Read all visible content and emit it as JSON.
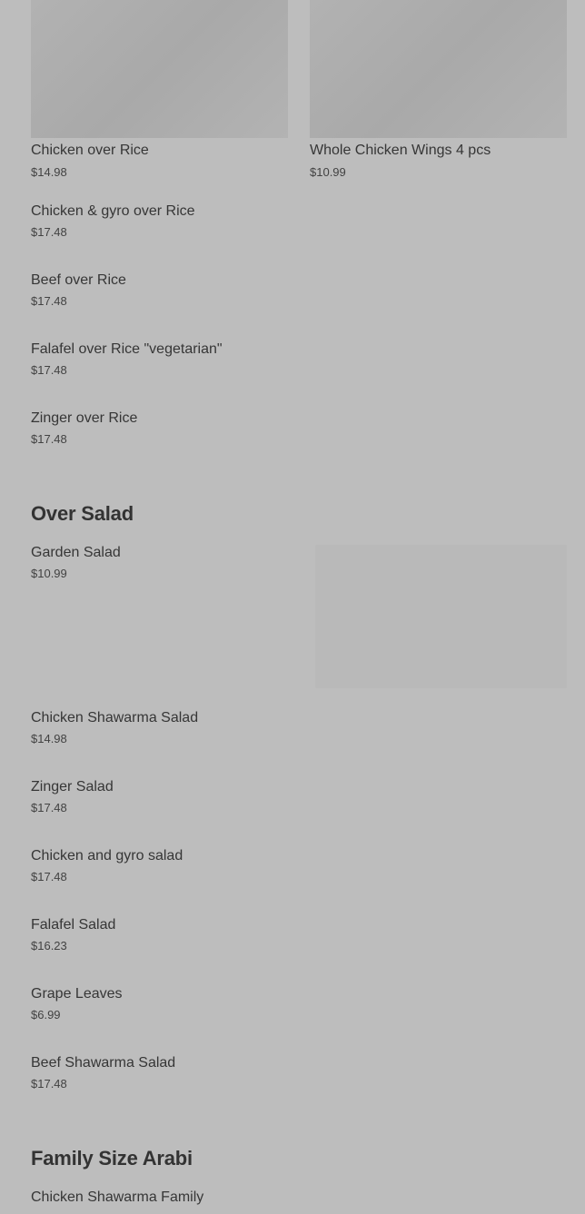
{
  "grid_items": [
    {
      "name": "Chicken over Rice",
      "price": "$14.98"
    },
    {
      "name": "Whole Chicken Wings 4 pcs",
      "price": "$10.99"
    }
  ],
  "rice_items": [
    {
      "name": "Chicken & gyro over Rice",
      "price": "$17.48"
    },
    {
      "name": "Beef over Rice",
      "price": "$17.48"
    },
    {
      "name": "Falafel over Rice \"vegetarian\"",
      "price": "$17.48"
    },
    {
      "name": "Zinger over Rice",
      "price": "$17.48"
    }
  ],
  "over_salad": {
    "title": "Over Salad",
    "items": [
      {
        "name": "Garden Salad",
        "price": "$10.99"
      },
      {
        "name": "Chicken Shawarma Salad",
        "price": "$14.98"
      },
      {
        "name": "Zinger Salad",
        "price": "$17.48"
      },
      {
        "name": "Chicken and gyro salad",
        "price": "$17.48"
      },
      {
        "name": "Falafel Salad",
        "price": "$16.23"
      },
      {
        "name": "Grape Leaves",
        "price": "$6.99"
      },
      {
        "name": "Beef Shawarma Salad",
        "price": "$17.48"
      }
    ]
  },
  "family_size": {
    "title": "Family Size Arabi",
    "items": [
      {
        "name": "Chicken Shawarma Family"
      }
    ]
  }
}
